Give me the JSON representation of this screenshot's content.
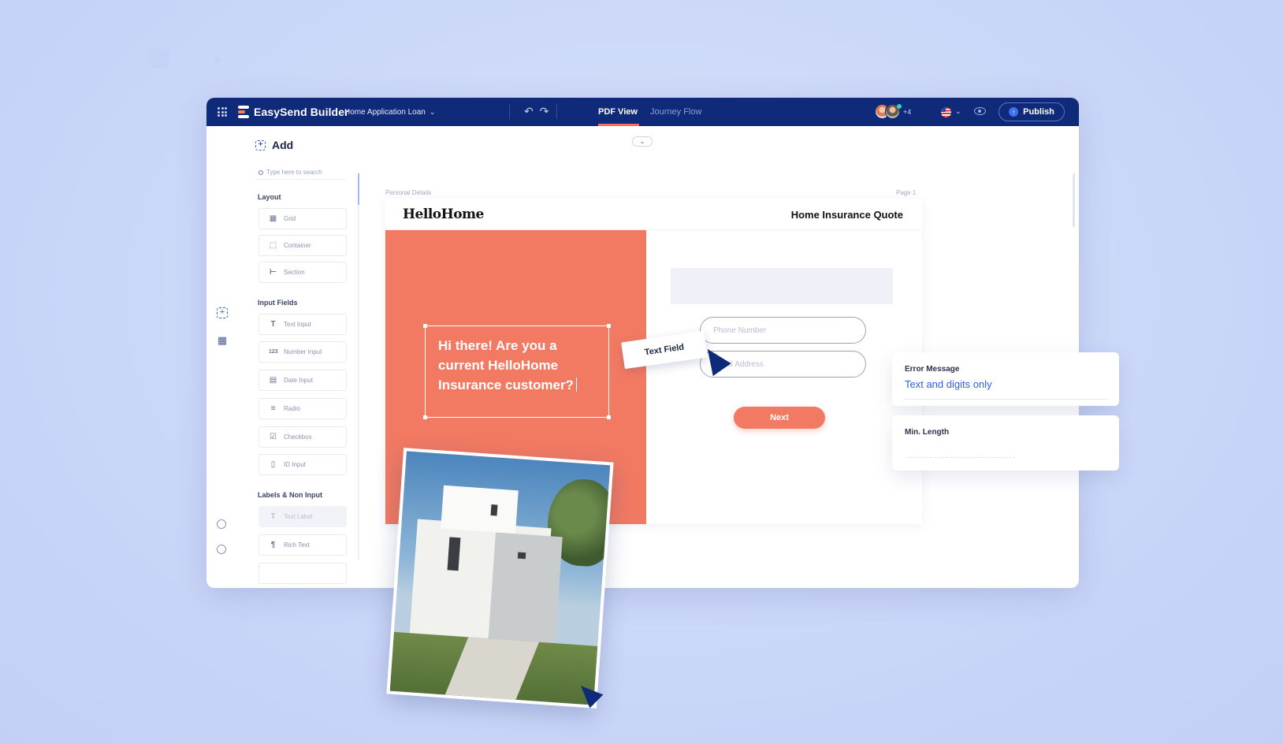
{
  "app": {
    "title": "EasySend Builder",
    "project": "Home Application Loan",
    "tabs": [
      {
        "label": "PDF View",
        "active": true
      },
      {
        "label": "Journey Flow",
        "active": false
      }
    ],
    "collaborators_extra": "+4",
    "publish_label": "Publish",
    "accent_color": "#0f2a78",
    "brand_color": "#f27a63"
  },
  "sidebar": {
    "title": "Add",
    "search_placeholder": "Type here to search",
    "groups": [
      {
        "label": "Layout",
        "items": [
          {
            "label": "Grid",
            "icon": "grid-icon"
          },
          {
            "label": "Container",
            "icon": "container-icon"
          },
          {
            "label": "Section",
            "icon": "section-icon"
          }
        ]
      },
      {
        "label": "Input Fields",
        "items": [
          {
            "label": "Text Input",
            "icon": "text-icon"
          },
          {
            "label": "Number Input",
            "icon": "number-icon"
          },
          {
            "label": "Date Input",
            "icon": "calendar-icon"
          },
          {
            "label": "Radio",
            "icon": "list-icon"
          },
          {
            "label": "Checkbox",
            "icon": "checkbox-icon"
          },
          {
            "label": "ID Input",
            "icon": "id-card-icon"
          }
        ]
      },
      {
        "label": "Labels & Non Input",
        "items": [
          {
            "label": "Text Label",
            "icon": "text-icon"
          },
          {
            "label": "Rich Text",
            "icon": "paragraph-icon"
          }
        ]
      }
    ]
  },
  "canvas": {
    "breadcrumb": "Personal Details",
    "page_label": "Page 1",
    "brand": "HelloHome",
    "form_title": "Home Insurance Quote",
    "headline": "Hi there! Are you a current HelloHome Insurance customer?",
    "phone_placeholder": "Phone Number",
    "email_placeholder": "Email Address",
    "next_label": "Next"
  },
  "floating": {
    "text_field_chip": "Text Field",
    "error_message_label": "Error Message",
    "error_message_value": "Text and digits only",
    "min_length_label": "Min. Length"
  }
}
